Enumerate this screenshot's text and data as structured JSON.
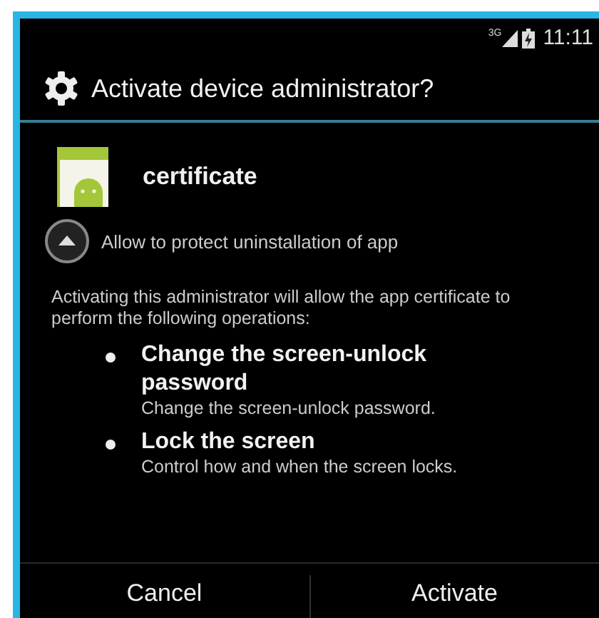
{
  "status_bar": {
    "network": "3G",
    "time": "11:11"
  },
  "dialog": {
    "title": "Activate device administrator?",
    "app_name": "certificate",
    "toggle_label": "Allow to protect uninstallation of app",
    "description": "Activating this administrator will allow the app certificate to perform the following operations:",
    "policies": [
      {
        "title": "Change the screen-unlock password",
        "detail": "Change the screen-unlock password."
      },
      {
        "title": "Lock the screen",
        "detail": "Control how and when the screen locks."
      }
    ],
    "buttons": [
      "Cancel",
      "Activate"
    ]
  }
}
